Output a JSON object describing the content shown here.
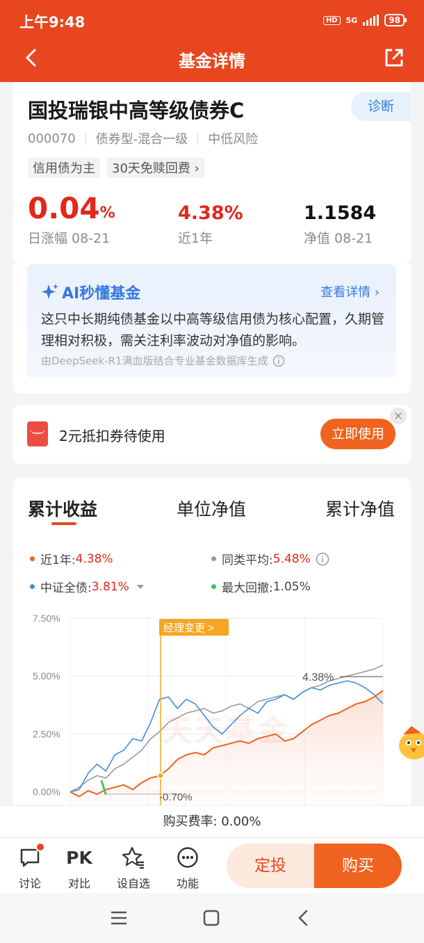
{
  "status": {
    "time": "上午9:48",
    "network": "5G",
    "battery": "98",
    "hd": "HD"
  },
  "nav": {
    "title": "基金详情"
  },
  "fund": {
    "name": "国投瑞银中高等级债券C",
    "diagnose_label": "诊断",
    "code": "000070",
    "type": "债券型-混合一级",
    "risk": "中低风险",
    "tags": [
      "信用债为主",
      "30天免赎回费 ›"
    ],
    "daily_change": {
      "value": "0.04",
      "unit": "%",
      "label": "日涨幅 08-21"
    },
    "one_year": {
      "value": "4.38%",
      "label": "近1年"
    },
    "nav_value": {
      "value": "1.1584",
      "label": "净值 08-21"
    }
  },
  "ai": {
    "title": "AI秒懂基金",
    "more": "查看详情 ›",
    "text": "这只中长期纯债基金以中高等级信用债为核心配置，久期管理相对积极，需关注利率波动对净值的影响。",
    "footnote": "由DeepSeek-R1满血版结合专业基金数据库生成"
  },
  "coupon": {
    "text": "2元抵扣券待使用",
    "button": "立即使用",
    "close": "×"
  },
  "chart_tabs": [
    "累计收益",
    "单位净值",
    "累计净值"
  ],
  "legend": [
    {
      "label": "近1年:",
      "value": "4.38%",
      "color": "#f0621f"
    },
    {
      "label": "同类平均:",
      "value": "5.48%",
      "color": "#999999"
    },
    {
      "label": "中证全债:",
      "value": "3.81%",
      "color": "#3d8ee0"
    },
    {
      "label": "最大回撤:",
      "value": "1.05%",
      "color": "#46c35a"
    }
  ],
  "chart_annotations": {
    "manager_change": "经理变更 >",
    "end_label": "4.38%",
    "drawdown_label": "-0.70%",
    "watermark": "天天基金"
  },
  "chart_data": {
    "type": "line",
    "y_ticks": [
      "7.50%",
      "5.00%",
      "2.50%",
      "0.00%"
    ],
    "ylim": [
      -0.7,
      7.5
    ],
    "grid": true,
    "series": [
      {
        "name": "近1年",
        "color": "#f0621f",
        "values": [
          0.0,
          -0.2,
          0.05,
          -0.1,
          0.1,
          0.2,
          0.3,
          0.1,
          0.4,
          0.6,
          0.7,
          1.0,
          1.4,
          1.6,
          1.7,
          1.6,
          1.9,
          2.0,
          2.1,
          2.2,
          2.1,
          2.3,
          2.4,
          2.5,
          2.2,
          2.3,
          2.6,
          2.9,
          3.1,
          3.3,
          3.4,
          3.6,
          3.8,
          3.9,
          4.1,
          4.38
        ]
      },
      {
        "name": "同类平均",
        "color": "#999999",
        "values": [
          0.0,
          0.2,
          0.5,
          0.7,
          0.6,
          1.0,
          1.2,
          1.5,
          1.8,
          2.3,
          2.6,
          3.0,
          3.2,
          3.4,
          3.5,
          3.6,
          3.4,
          3.5,
          3.7,
          3.8,
          3.6,
          3.9,
          4.0,
          4.1,
          4.2,
          4.0,
          4.3,
          4.5,
          4.6,
          4.8,
          4.9,
          5.0,
          5.1,
          5.2,
          5.3,
          5.48
        ]
      },
      {
        "name": "中证全债",
        "color": "#3d8ee0",
        "values": [
          0.0,
          0.1,
          0.8,
          1.2,
          0.9,
          1.6,
          1.8,
          2.3,
          2.2,
          3.0,
          4.0,
          4.1,
          3.6,
          4.0,
          3.8,
          3.3,
          2.8,
          2.5,
          2.9,
          3.3,
          3.6,
          3.4,
          3.9,
          4.0,
          4.2,
          4.0,
          4.3,
          4.5,
          4.4,
          4.6,
          4.7,
          4.8,
          4.7,
          4.5,
          4.2,
          3.81
        ]
      }
    ]
  },
  "fee": {
    "text": "购买费率: 0.00%"
  },
  "bottom": {
    "items": [
      "讨论",
      "对比",
      "设自选",
      "功能"
    ],
    "pk": "PK",
    "dingtou": "定投",
    "buy": "购买"
  }
}
